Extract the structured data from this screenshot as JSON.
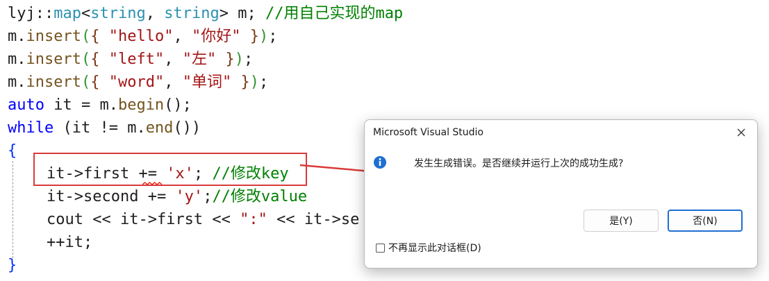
{
  "code": {
    "l1": {
      "ns": "lyj",
      "sep": "::",
      "tpl": "map",
      "lt": "<",
      "t1": "string",
      "comma": ", ",
      "t2": "string",
      "gt": ">",
      "rest": " m; ",
      "comment": "//用自己实现的map"
    },
    "insert_calls": [
      {
        "obj": "m.",
        "fn": "insert",
        "key": "\"hello\"",
        "val": "\"你好\""
      },
      {
        "obj": "m.",
        "fn": "insert",
        "key": "\"left\"",
        "val": "\"左\""
      },
      {
        "obj": "m.",
        "fn": "insert",
        "key": "\"word\"",
        "val": "\"单词\""
      }
    ],
    "l5": {
      "kw": "auto",
      "rest": " it = m.",
      "fn": "begin",
      "end": "();"
    },
    "l6": {
      "kw": "while",
      "mid": " (it != m.",
      "fn": "end",
      "end": "())"
    },
    "open_brace": "{",
    "l8": {
      "code": "it->first += ",
      "ch": "'x'",
      "semi": "; ",
      "comment": "//修改key"
    },
    "l9": {
      "code": "it->second += ",
      "ch": "'y'",
      "semi": ";",
      "comment": "//修改value"
    },
    "l10": {
      "code": "cout << it->first << ",
      "str": "\":\"",
      "tail": " << it->se"
    },
    "l11": "++it;",
    "close_brace": "}"
  },
  "dialog": {
    "title": "Microsoft Visual Studio",
    "icon": "info-icon",
    "message": "发生生成错误。是否继续并运行上次的成功生成?",
    "yes_label": "是(Y)",
    "no_label": "否(N)",
    "checkbox_label": "不再显示此对话框(D)"
  },
  "colors": {
    "keyword": "#0000ff",
    "string": "#a31515",
    "comment": "#008000",
    "annotation": "#d93a3a",
    "accent": "#1f6fd1"
  }
}
